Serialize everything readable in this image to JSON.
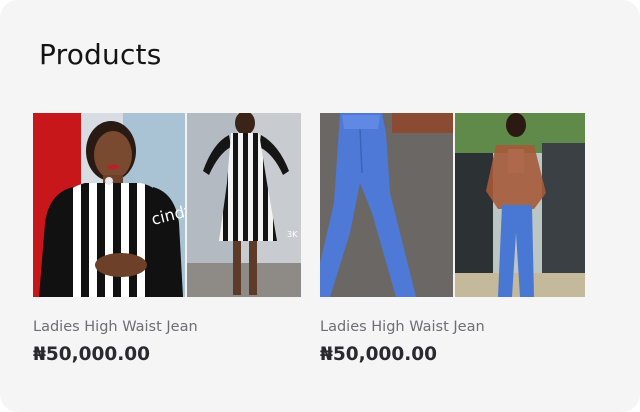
{
  "page": {
    "title": "Products"
  },
  "products": [
    {
      "name": "Ladies High Waist Jean",
      "price": "₦50,000.00",
      "watermark": "cindy",
      "corner_mark": "3K"
    },
    {
      "name": "Ladies High Waist Jean",
      "price": "₦50,000.00"
    }
  ],
  "colors": {
    "card_background": "#f5f5f6",
    "title_text": "#141414",
    "product_name_text": "#6e6e73",
    "price_text": "#2a2a2e"
  }
}
